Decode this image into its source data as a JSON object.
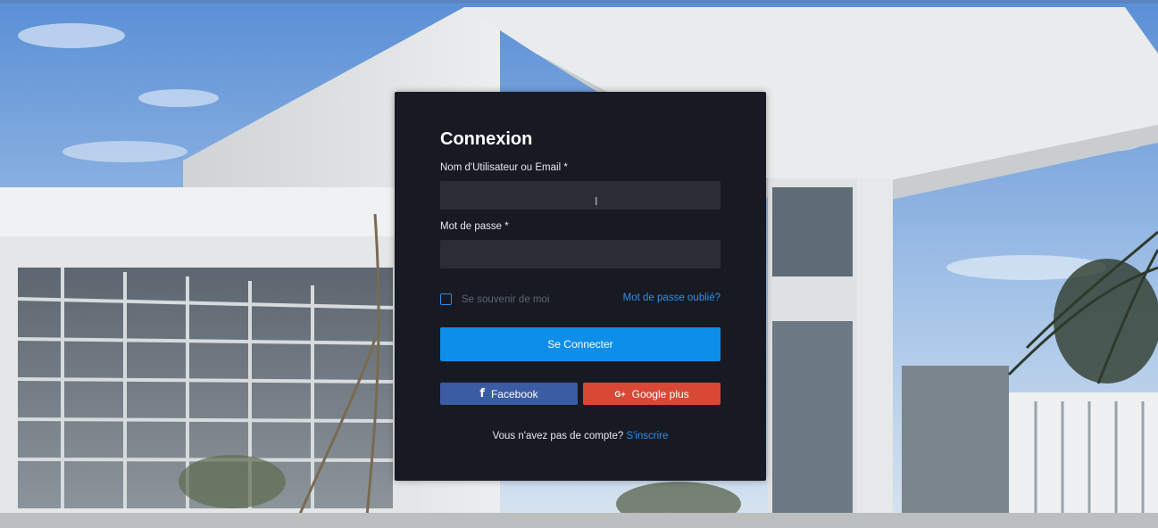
{
  "login": {
    "title": "Connexion",
    "username_label": "Nom d'Utilisateur ou Email *",
    "username_value": "",
    "password_label": "Mot de passe *",
    "password_value": "",
    "remember_label": "Se souvenir de moi",
    "remember_checked": false,
    "forgot_link": "Mot de passe oublié?",
    "submit_label": "Se Connecter",
    "facebook_label": "Facebook",
    "facebook_icon": "facebook-f-icon",
    "google_label": "Google plus",
    "google_icon": "google-plus-icon",
    "no_account_text": "Vous n'avez pas de compte?",
    "signup_link": "S'inscrire"
  },
  "colors": {
    "card_bg": "#171a22",
    "input_bg": "#2a2d36",
    "primary": "#0d8ee9",
    "link": "#2f8eea",
    "facebook": "#3b5ba3",
    "google": "#d94735"
  }
}
